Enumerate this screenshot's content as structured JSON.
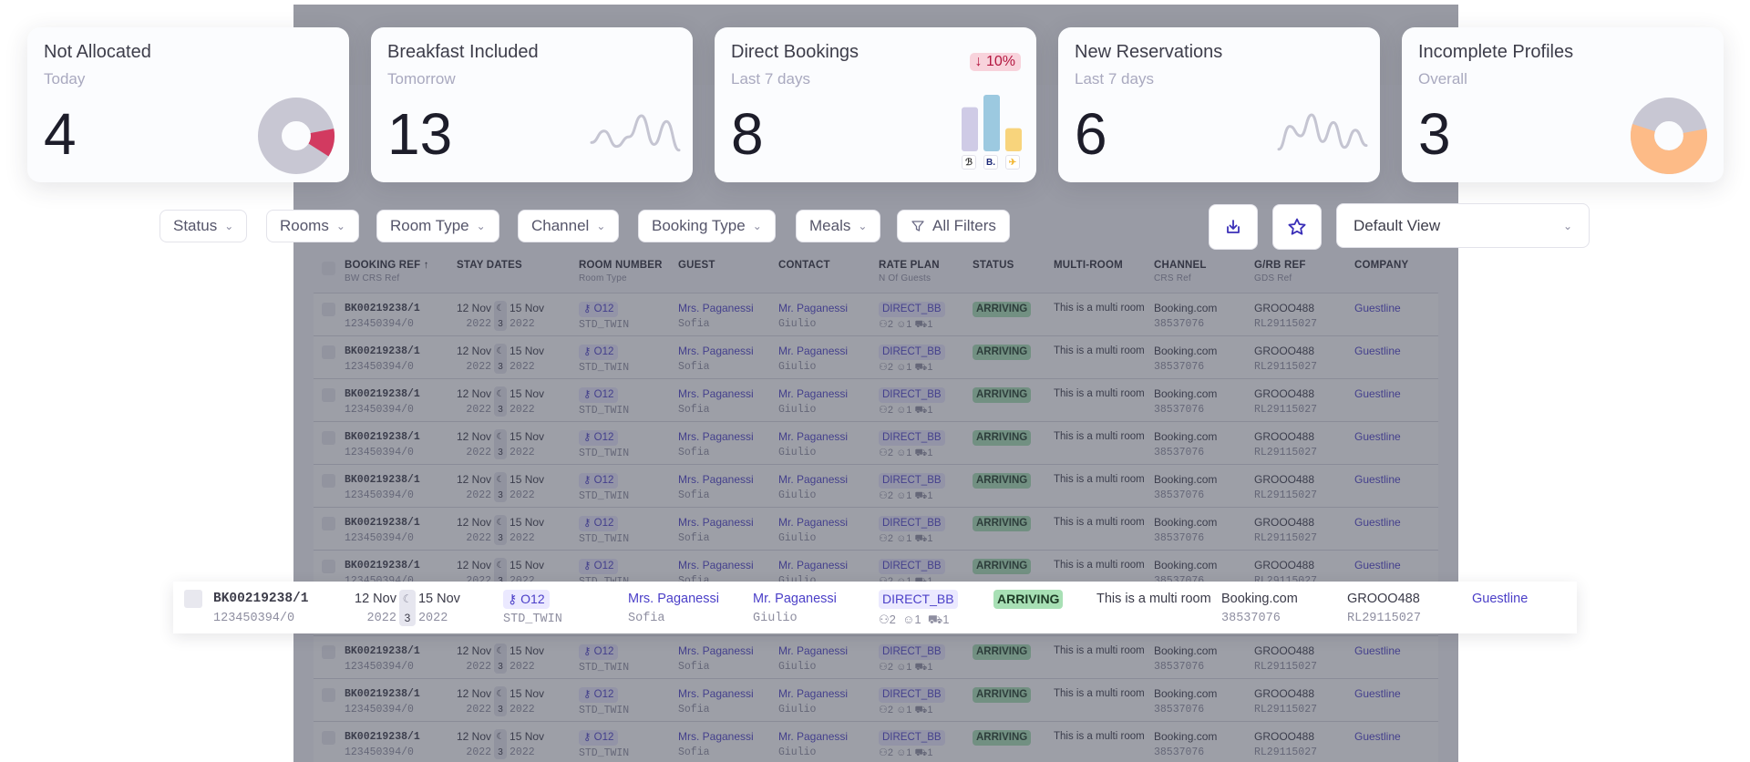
{
  "cards": [
    {
      "title": "Not Allocated",
      "subtitle": "Today",
      "value": "4",
      "viz": "donut",
      "viz_data": {
        "highlight_fraction": 0.12,
        "highlight_color": "#d23a60",
        "base_color": "#c8c7d3"
      }
    },
    {
      "title": "Breakfast Included",
      "subtitle": "Tomorrow",
      "value": "13",
      "viz": "sparkline",
      "viz_data": {
        "points": [
          0.3,
          0.6,
          0.2,
          0.45,
          1.0,
          0.25,
          0.85,
          0.1
        ]
      }
    },
    {
      "title": "Direct Bookings",
      "subtitle": "Last 7 days",
      "value": "8",
      "delta": "10%",
      "delta_direction": "down",
      "viz": "bars",
      "viz_data": {
        "bars": [
          {
            "channel": "direct-logo",
            "value": 0.78,
            "color": "#cfcbe6"
          },
          {
            "channel": "booking-com-logo",
            "value": 1.0,
            "color": "#9cc9e0"
          },
          {
            "channel": "expedia-logo",
            "value": 0.41,
            "color": "#f8d47c"
          }
        ]
      },
      "logos": [
        "ℬ",
        "B.",
        "✈"
      ]
    },
    {
      "title": "New Reservations",
      "subtitle": "Last 7 days",
      "value": "6",
      "viz": "sparkline",
      "viz_data": {
        "points": [
          0.1,
          0.7,
          0.45,
          1.0,
          0.3,
          0.8,
          0.15,
          0.6,
          0.2
        ]
      }
    },
    {
      "title": "Incomplete Profiles",
      "subtitle": "Overall",
      "value": "3",
      "viz": "donut",
      "viz_data": {
        "highlight_fraction": 0.58,
        "highlight_color": "#fdbb87",
        "base_color": "#c8c7d3"
      }
    }
  ],
  "filters": {
    "status": "Status",
    "rooms": "Rooms",
    "room_type": "Room Type",
    "channel": "Channel",
    "booking_type": "Booking Type",
    "meals": "Meals",
    "all_filters": "All Filters"
  },
  "view": {
    "selected": "Default View"
  },
  "table": {
    "columns": [
      {
        "label": "BOOKING REF",
        "sub": "BW CRS Ref"
      },
      {
        "label": "STAY DATES",
        "sub": ""
      },
      {
        "label": "ROOM NUMBER",
        "sub": "Room Type"
      },
      {
        "label": "GUEST",
        "sub": ""
      },
      {
        "label": "CONTACT",
        "sub": ""
      },
      {
        "label": "RATE PLAN",
        "sub": "N Of Guests"
      },
      {
        "label": "STATUS",
        "sub": ""
      },
      {
        "label": "MULTI-ROOM",
        "sub": ""
      },
      {
        "label": "CHANNEL",
        "sub": "CRS Ref"
      },
      {
        "label": "G/RB REF",
        "sub": "GDS Ref"
      },
      {
        "label": "COMPANY",
        "sub": ""
      }
    ],
    "row": {
      "booking_ref": "BK00219238/1",
      "crs_ref": "123450394/0",
      "arrive_day": "12 Nov",
      "arrive_year": "2022",
      "nights": "3",
      "depart_day": "15 Nov",
      "depart_year": "2022",
      "room_number": "O12",
      "room_type": "STD_TWIN",
      "guest": "Mrs. Paganessi",
      "guest_first": "Sofia",
      "contact": "Mr. Paganessi",
      "contact_first": "Giulio",
      "rate_plan": "DIRECT_BB",
      "adults": "2",
      "children": "1",
      "infants": "1",
      "status": "ARRIVING",
      "multi_room": "This is a multi room",
      "channel": "Booking.com",
      "channel_ref": "38537076",
      "grb_ref": "GROOO488",
      "gds_ref": "RL29115027",
      "company": "Guestline"
    },
    "row_count": 11
  }
}
